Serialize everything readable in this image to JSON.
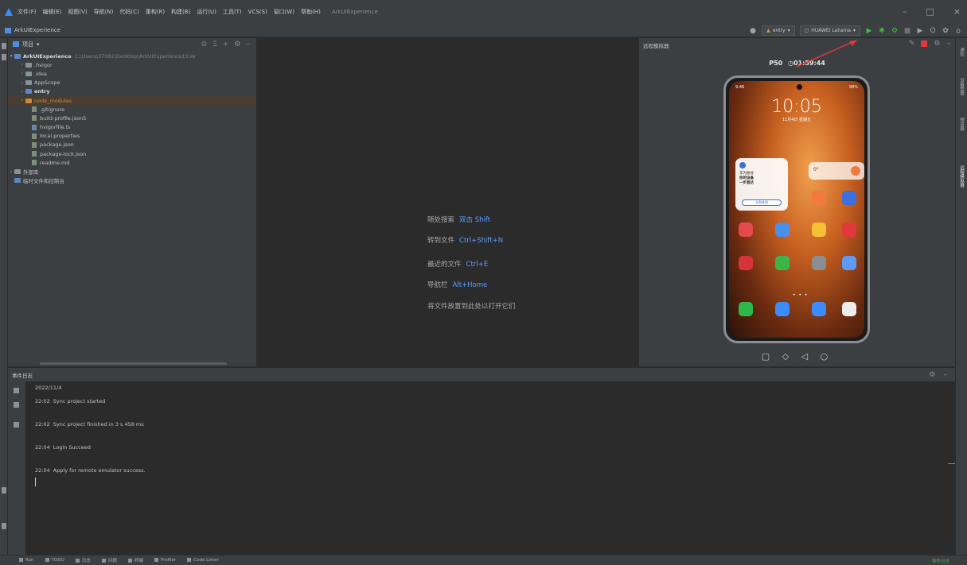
{
  "window": {
    "menus": [
      "文件(F)",
      "编辑(E)",
      "视图(V)",
      "导航(N)",
      "代码(C)",
      "重构(R)",
      "构建(B)",
      "运行(U)",
      "工具(T)",
      "VCS(S)",
      "窗口(W)",
      "帮助(H)"
    ],
    "project_title": "ArkUIExperience",
    "controls": {
      "minimize": "–",
      "maximize": "□",
      "close": "×"
    }
  },
  "toolbar": {
    "breadcrumb": "ArkUIExperience",
    "module_select": "entry",
    "device_select": "HUAWEI Lahaina",
    "run_label": "▶",
    "debug_label": "✱",
    "attach_label": "⚙",
    "stop_label": "■",
    "search_label": "Q",
    "settings_label": "✿",
    "account_label": "⌂"
  },
  "project_panel": {
    "title": "项目",
    "tools": [
      "⊙",
      "Ξ",
      "÷",
      "⚙",
      "–"
    ],
    "root_name": "ArkUIExperience",
    "root_path": "C:\\Users\\37082\\Desktop\\ArkUIExperience11\\Ar",
    "items": [
      {
        "name": ".hvigor",
        "kind": "folder"
      },
      {
        "name": ".idea",
        "kind": "folder"
      },
      {
        "name": "AppScope",
        "kind": "folder"
      },
      {
        "name": "entry",
        "kind": "module"
      },
      {
        "name": "node_modules",
        "kind": "orange"
      },
      {
        "name": ".gitignore",
        "kind": "file"
      },
      {
        "name": "build-profile.json5",
        "kind": "file"
      },
      {
        "name": "hvigorfile.ts",
        "kind": "json"
      },
      {
        "name": "local.properties",
        "kind": "file"
      },
      {
        "name": "package.json",
        "kind": "file"
      },
      {
        "name": "package-lock.json",
        "kind": "file"
      },
      {
        "name": "readme.md",
        "kind": "file"
      }
    ],
    "external_libs": "外部库",
    "scratches": "临时文件和控制台"
  },
  "editor": {
    "hints": [
      {
        "label": "随处搜索",
        "key": "双击 Shift"
      },
      {
        "label": "转到文件",
        "key": "Ctrl+Shift+N"
      },
      {
        "label": "最近的文件",
        "key": "Ctrl+E"
      },
      {
        "label": "导航栏",
        "key": "Alt+Home"
      },
      {
        "label": "将文件放置到此处以打开它们",
        "key": ""
      }
    ]
  },
  "emulator": {
    "title": "远程模拟器",
    "device_name": "P50",
    "timer": "01:59:44",
    "phone": {
      "status_left": "9:46",
      "status_right": "98%",
      "clock": "10:05",
      "date": "11月4日 星期五",
      "widget_line1": "华为账号",
      "widget_line2": "你的设备",
      "widget_line3": "一步直达",
      "widget_button": "立即体验",
      "widget_small": "0°",
      "page_dots": "• • •"
    },
    "nav_buttons": "▢ ◇ ◁ ○"
  },
  "right_stripe": [
    "通知",
    "设备管理",
    "预览器",
    "远程模拟器"
  ],
  "log_panel": {
    "title": "事件日志",
    "date": "2022/11/4",
    "entries": [
      {
        "time": "22:02",
        "text": "Sync project started"
      },
      {
        "time": "22:02",
        "text": "Sync project finished in 3 s 458 ms"
      },
      {
        "time": "22:04",
        "text": "Login Succeed"
      },
      {
        "time": "22:04",
        "text": "Apply for remote emulator success."
      }
    ]
  },
  "status_bar": {
    "items": [
      "Run",
      "TODO",
      "日志",
      "问题",
      "终端",
      "Profiler",
      "Code Linter"
    ],
    "right": "事件日志"
  }
}
